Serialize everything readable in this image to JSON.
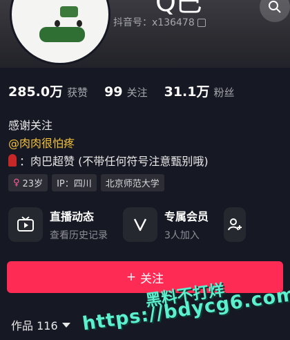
{
  "header": {
    "title_partial": "Q巴",
    "account_label": "抖音号：x136478"
  },
  "stats": [
    {
      "value": "285.0万",
      "label": "获赞"
    },
    {
      "value": "99",
      "label": "关注"
    },
    {
      "value": "31.1万",
      "label": "粉丝"
    }
  ],
  "bio": {
    "line1": "感谢关注",
    "line2": "@肉肉很怕疼",
    "line3": "：肉巴超赞 (不带任何符号注意甄别哦)"
  },
  "tags": {
    "gender_symbol": "♀",
    "age": "23岁",
    "ip": "IP：四川",
    "school": "北京师范大学"
  },
  "features": [
    {
      "title": "直播动态",
      "subtitle": "查看历史记录",
      "icon": "tv-icon"
    },
    {
      "title": "专属会员",
      "subtitle": "3人加入",
      "icon": "v-icon"
    }
  ],
  "follow_button": {
    "label": "关注",
    "plus": "+"
  },
  "works": {
    "label": "作品 116"
  },
  "watermark": {
    "line1": "黑料不打烊",
    "line2": "https://bdycg6.com"
  },
  "colors": {
    "background": "#161823",
    "accent": "#fe2c55",
    "mention": "#f4c33b"
  }
}
